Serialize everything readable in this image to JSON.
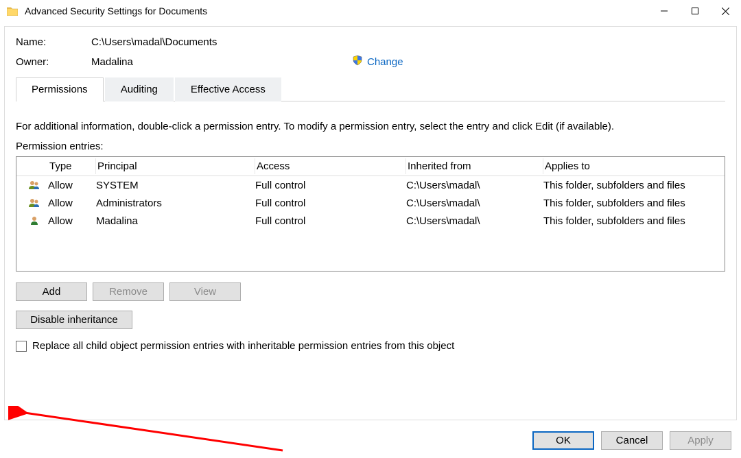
{
  "window": {
    "title": "Advanced Security Settings for Documents"
  },
  "info": {
    "name_label": "Name:",
    "name_value": "C:\\Users\\madal\\Documents",
    "owner_label": "Owner:",
    "owner_value": "Madalina",
    "change_label": "Change"
  },
  "tabs": {
    "permissions": "Permissions",
    "auditing": "Auditing",
    "effective_access": "Effective Access"
  },
  "instructions": "For additional information, double-click a permission entry. To modify a permission entry, select the entry and click Edit (if available).",
  "entries_label": "Permission entries:",
  "headers": {
    "type": "Type",
    "principal": "Principal",
    "access": "Access",
    "inherited": "Inherited from",
    "applies": "Applies to"
  },
  "rows": [
    {
      "icon": "people",
      "type": "Allow",
      "principal": "SYSTEM",
      "access": "Full control",
      "inherited": "C:\\Users\\madal\\",
      "applies": "This folder, subfolders and files"
    },
    {
      "icon": "people",
      "type": "Allow",
      "principal": "Administrators",
      "access": "Full control",
      "inherited": "C:\\Users\\madal\\",
      "applies": "This folder, subfolders and files"
    },
    {
      "icon": "person",
      "type": "Allow",
      "principal": "Madalina",
      "access": "Full control",
      "inherited": "C:\\Users\\madal\\",
      "applies": "This folder, subfolders and files"
    }
  ],
  "buttons": {
    "add": "Add",
    "remove": "Remove",
    "view": "View",
    "disable_inherit": "Disable inheritance",
    "ok": "OK",
    "cancel": "Cancel",
    "apply": "Apply"
  },
  "checkbox_label": "Replace all child object permission entries with inheritable permission entries from this object"
}
